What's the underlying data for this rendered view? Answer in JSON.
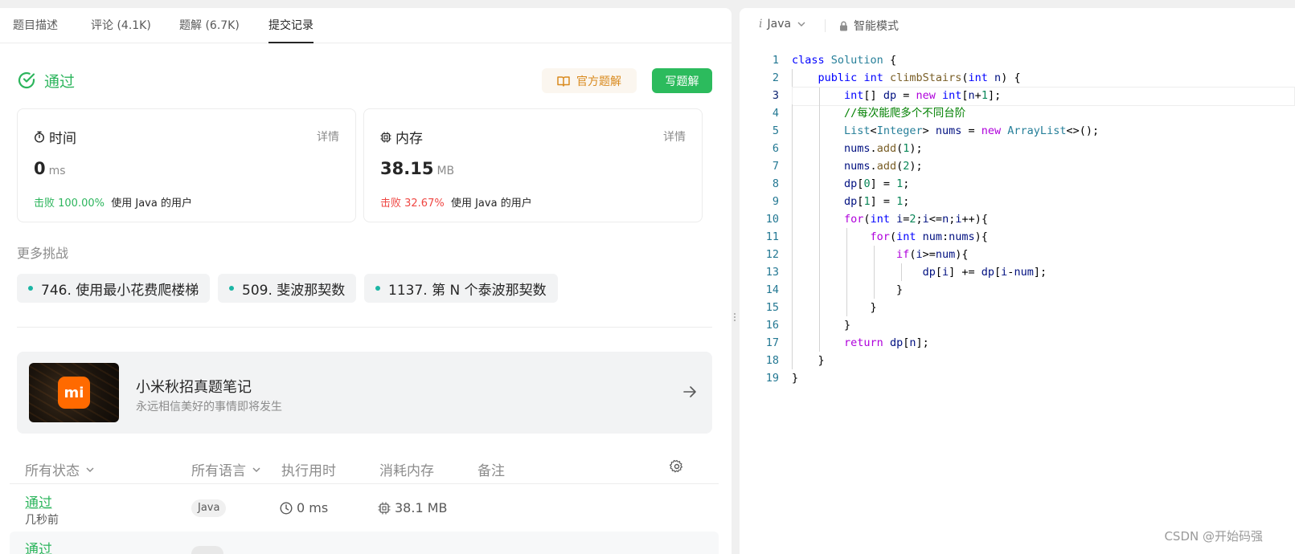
{
  "tabs": [
    "题目描述",
    "评论 (4.1K)",
    "题解 (6.7K)",
    "提交记录"
  ],
  "status": {
    "label": "通过",
    "color": "#2db55d"
  },
  "buttons": {
    "official": "官方题解",
    "write": "写题解"
  },
  "runtime": {
    "label": "时间",
    "detail": "详情",
    "value": "0",
    "unit": "ms",
    "beats_pct": "击败 100.00%",
    "beats_rest": "使用 Java 的用户"
  },
  "memory": {
    "label": "内存",
    "detail": "详情",
    "value": "38.15",
    "unit": "MB",
    "beats_pct": "击败 32.67%",
    "beats_rest": "使用 Java 的用户"
  },
  "more": {
    "title": "更多挑战",
    "items": [
      "746. 使用最小花费爬楼梯",
      "509. 斐波那契数",
      "1137. 第 N 个泰波那契数"
    ]
  },
  "promo": {
    "title": "小米秋招真题笔记",
    "subtitle": "永远相信美好的事情即将发生",
    "logo_text": "mi"
  },
  "table": {
    "headers": [
      "所有状态",
      "所有语言",
      "执行用时",
      "消耗内存",
      "备注"
    ],
    "rows": [
      {
        "status": "通过",
        "time_ago": "几秒前",
        "lang": "Java",
        "runtime": "0 ms",
        "memory": "38.1 MB"
      },
      {
        "status": "通过"
      }
    ]
  },
  "editor": {
    "language": "Java",
    "mode": "智能模式",
    "current_line": 3,
    "line_numbers": [
      "1",
      "2",
      "3",
      "4",
      "5",
      "6",
      "7",
      "8",
      "9",
      "10",
      "11",
      "12",
      "13",
      "14",
      "15",
      "16",
      "17",
      "18",
      "19"
    ]
  },
  "watermark": "CSDN @开始码强",
  "icons": {
    "status": "check-circle-icon",
    "official": "book-open-icon",
    "runtime": "stopwatch-icon",
    "memory": "chip-icon",
    "promo_arrow": "arrow-right-icon",
    "settings": "gear-icon",
    "lang_caret": "chevron-down-icon",
    "lock": "lock-icon"
  }
}
